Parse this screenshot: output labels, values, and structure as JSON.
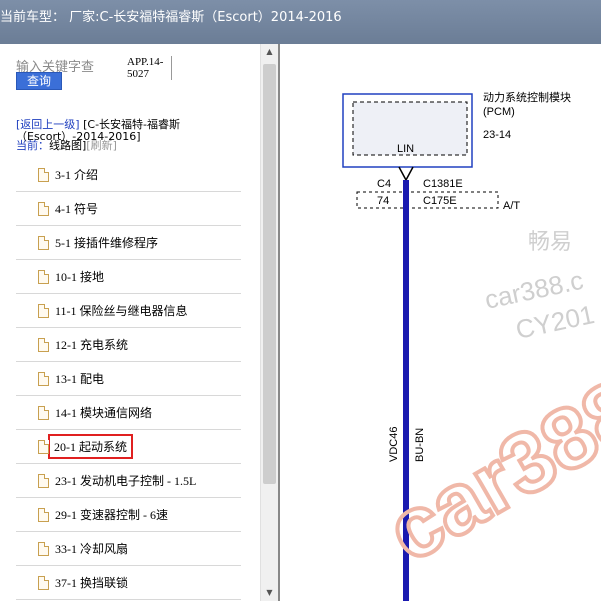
{
  "title_bar": {
    "text": "当前车型：  厂家:C-长安福特福睿斯（Escort）2014-2016",
    "dot": "."
  },
  "search": {
    "hint": "输入关键字查",
    "button": "查询"
  },
  "app_code": "APP.14-5027",
  "nav": {
    "back": "[返回上一级]",
    "model_line1": "[C-长安福特-福睿斯",
    "model_line2": "（Escort）-2014-2016]",
    "current_prefix": "当前：",
    "current_link": "线路图]",
    "refresh": "[刷新]"
  },
  "menu": [
    "3-1 介绍",
    "4-1 符号",
    "5-1 接插件维修程序",
    "10-1 接地",
    "11-1 保险丝与继电器信息",
    "12-1 充电系统",
    "13-1 配电",
    "14-1 模块通信网络",
    "20-1 起动系统",
    "23-1 发动机电子控制 - 1.5L",
    "29-1 变速器控制 - 6速",
    "33-1 冷却风扇",
    "37-1 换挡联锁"
  ],
  "highlighted_index": 8,
  "diagram": {
    "module_name": "动力系统控制模块",
    "module_abbr": "(PCM)",
    "module_page": "23-14",
    "pin_label": "LIN",
    "conn_a_pin": "C4",
    "conn_a_name": "C1381E",
    "conn_b_pin": "74",
    "conn_b_name": "C175E",
    "conn_b_note": "A/T",
    "circuit": "VDC46",
    "wire_color": "BU-BN",
    "wire_color_hex": "#1a1ab0",
    "watermark_1": "畅易",
    "watermark_2": "car388.c",
    "watermark_3": "CY201",
    "watermark_4": "car388"
  }
}
